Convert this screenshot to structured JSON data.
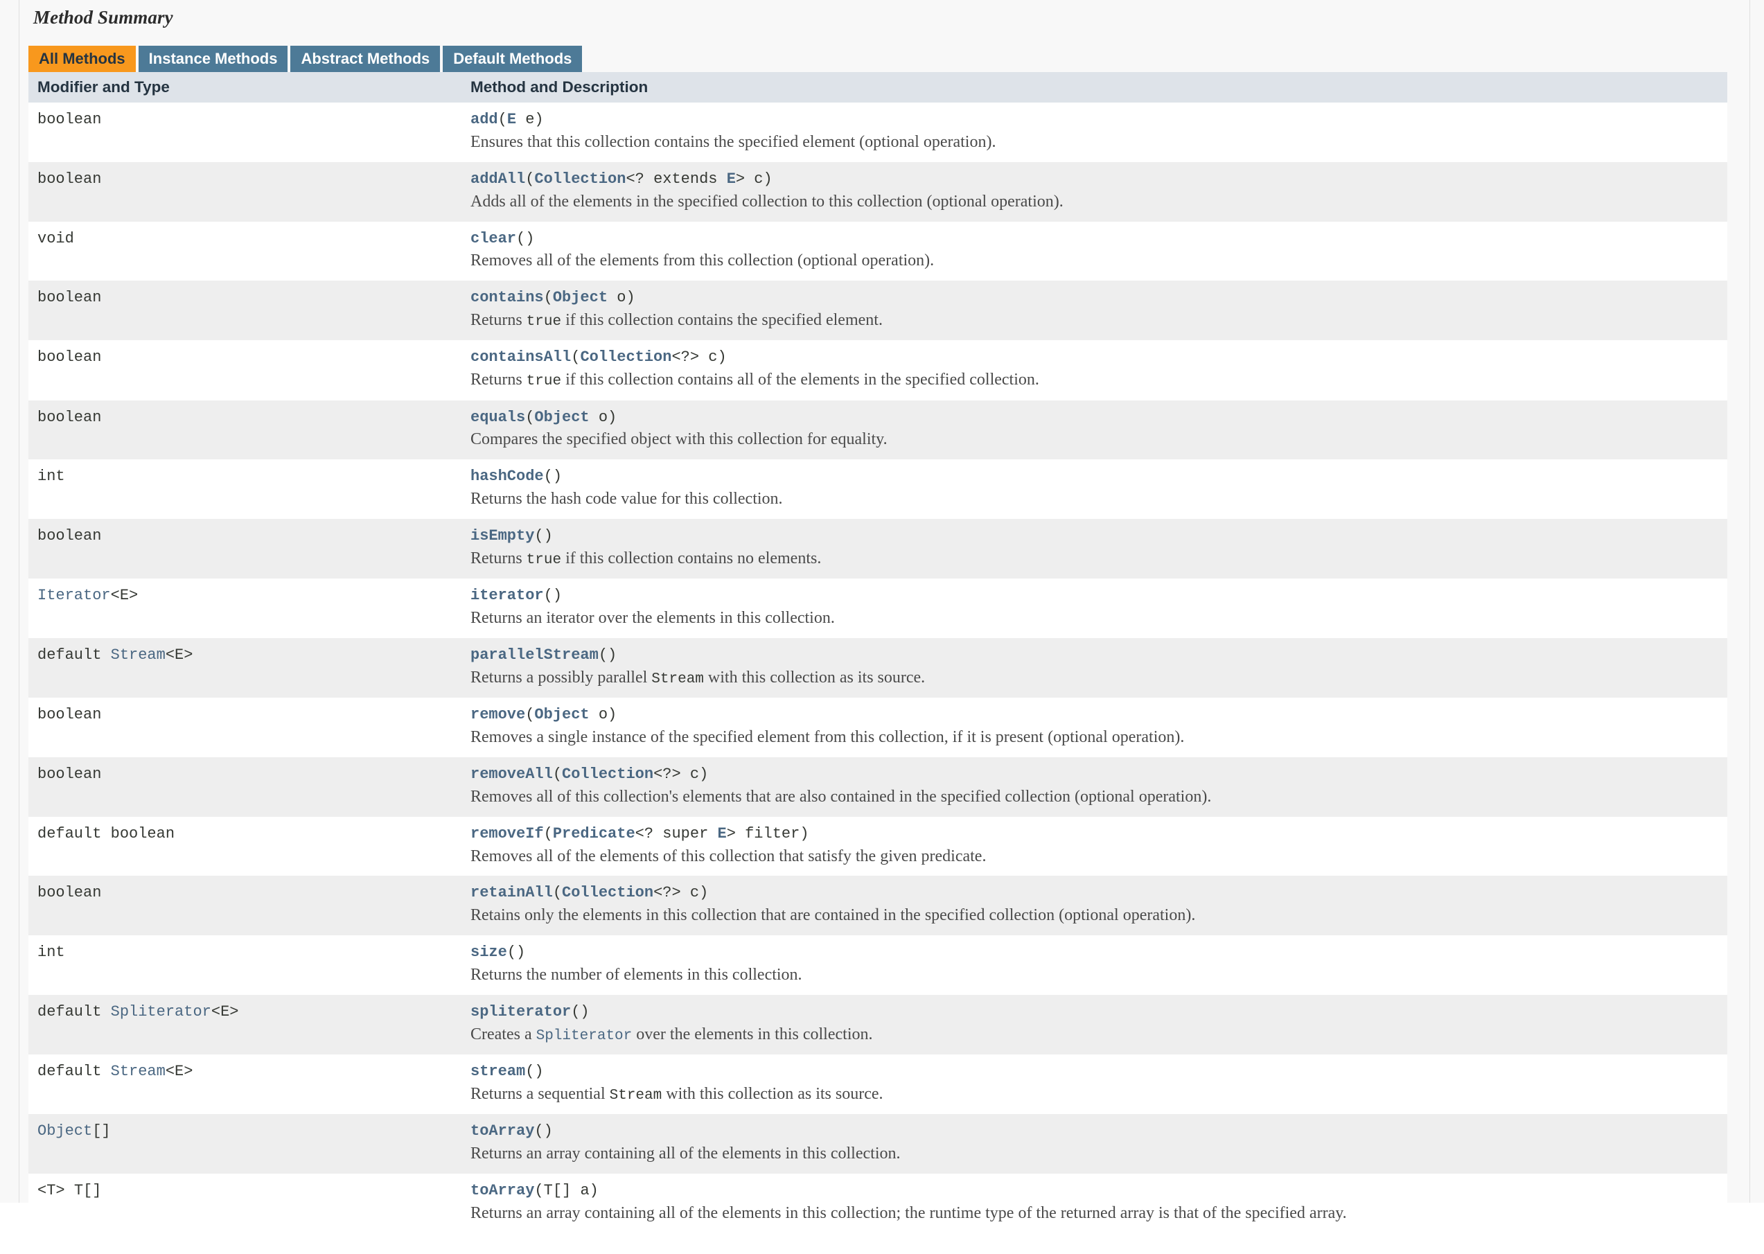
{
  "section": {
    "title": "Method Summary"
  },
  "tabs": [
    {
      "label": "All Methods",
      "active": true
    },
    {
      "label": "Instance Methods",
      "active": false
    },
    {
      "label": "Abstract Methods",
      "active": false
    },
    {
      "label": "Default Methods",
      "active": false
    }
  ],
  "colors": {
    "tab_active_bg": "#f8981d",
    "tab_active_text": "#253441",
    "tab_inactive_bg": "#4d7a97",
    "tab_inactive_text": "#ffffff",
    "header_bg": "#dee3e9",
    "row_bg": "#ffffff",
    "alt_row_bg": "#eeeeee",
    "link": "#4a6782",
    "text": "#353833",
    "page_bg": "#f8f8f8"
  },
  "table": {
    "headers": [
      "Modifier and Type",
      "Method and Description"
    ],
    "rows": [
      {
        "modifier": "boolean",
        "method": "add(E e)",
        "description": "Ensures that this collection contains the specified element (optional operation)."
      },
      {
        "modifier": "boolean",
        "method": "addAll(Collection<? extends E> c)",
        "description": "Adds all of the elements in the specified collection to this collection (optional operation)."
      },
      {
        "modifier": "void",
        "method": "clear()",
        "description": "Removes all of the elements from this collection (optional operation)."
      },
      {
        "modifier": "boolean",
        "method": "contains(Object o)",
        "description": "Returns true if this collection contains the specified element."
      },
      {
        "modifier": "boolean",
        "method": "containsAll(Collection<?> c)",
        "description": "Returns true if this collection contains all of the elements in the specified collection."
      },
      {
        "modifier": "boolean",
        "method": "equals(Object o)",
        "description": "Compares the specified object with this collection for equality."
      },
      {
        "modifier": "int",
        "method": "hashCode()",
        "description": "Returns the hash code value for this collection."
      },
      {
        "modifier": "boolean",
        "method": "isEmpty()",
        "description": "Returns true if this collection contains no elements."
      },
      {
        "modifier": "Iterator<E>",
        "method": "iterator()",
        "description": "Returns an iterator over the elements in this collection."
      },
      {
        "modifier": "default Stream<E>",
        "method": "parallelStream()",
        "description": "Returns a possibly parallel Stream with this collection as its source."
      },
      {
        "modifier": "boolean",
        "method": "remove(Object o)",
        "description": "Removes a single instance of the specified element from this collection, if it is present (optional operation)."
      },
      {
        "modifier": "boolean",
        "method": "removeAll(Collection<?> c)",
        "description": "Removes all of this collection's elements that are also contained in the specified collection (optional operation)."
      },
      {
        "modifier": "default boolean",
        "method": "removeIf(Predicate<? super E> filter)",
        "description": "Removes all of the elements of this collection that satisfy the given predicate."
      },
      {
        "modifier": "boolean",
        "method": "retainAll(Collection<?> c)",
        "description": "Retains only the elements in this collection that are contained in the specified collection (optional operation)."
      },
      {
        "modifier": "int",
        "method": "size()",
        "description": "Returns the number of elements in this collection."
      },
      {
        "modifier": "default Spliterator<E>",
        "method": "spliterator()",
        "description": "Creates a Spliterator over the elements in this collection."
      },
      {
        "modifier": "default Stream<E>",
        "method": "stream()",
        "description": "Returns a sequential Stream with this collection as its source."
      },
      {
        "modifier": "Object[]",
        "method": "toArray()",
        "description": "Returns an array containing all of the elements in this collection."
      },
      {
        "modifier": "<T> T[]",
        "method": "toArray(T[] a)",
        "description": "Returns an array containing all of the elements in this collection; the runtime type of the returned array is that of the specified array."
      }
    ]
  },
  "render_hints": {
    "modifier_links": [
      "Iterator",
      "Stream",
      "Spliterator",
      "Object"
    ],
    "signature_links": [
      "Collection",
      "E",
      "Object",
      "Predicate"
    ],
    "description_mono_plain": [
      "true",
      "Stream"
    ],
    "description_mono_link": [
      "Spliterator"
    ]
  }
}
